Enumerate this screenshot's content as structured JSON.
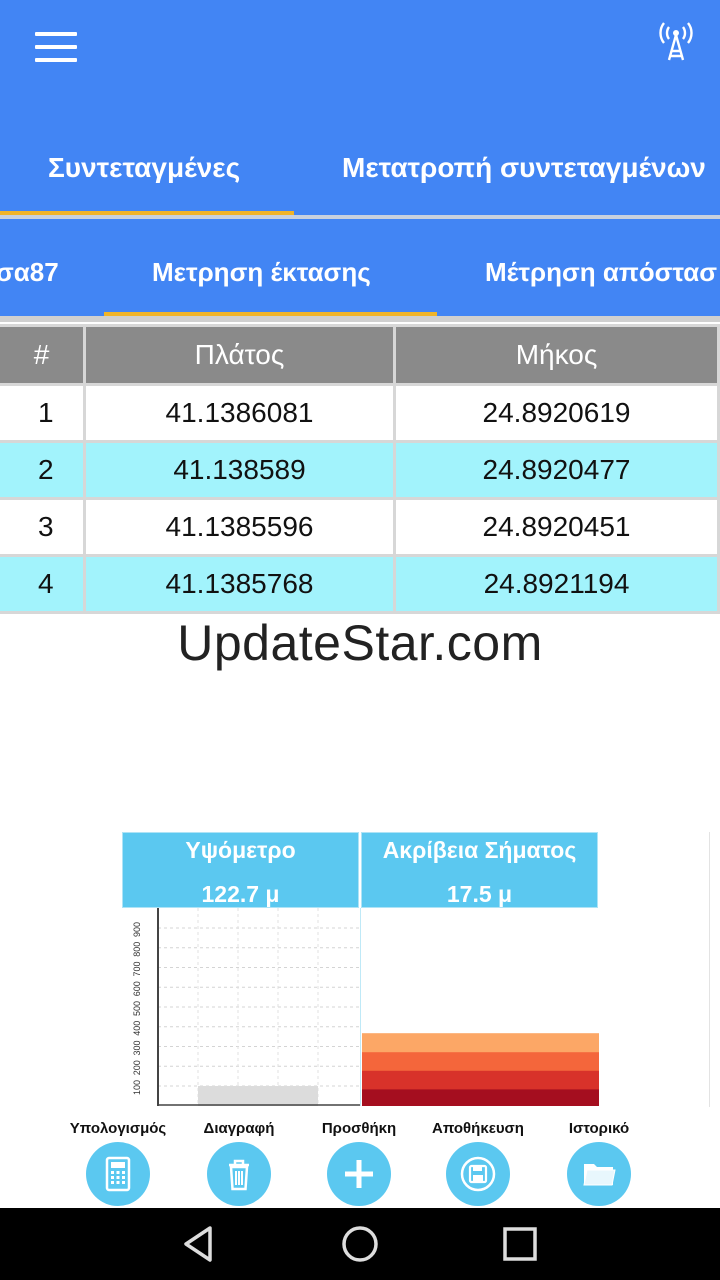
{
  "header": {
    "menu_icon": "hamburger-menu-icon",
    "gps_icon": "antenna-icon",
    "color": "#4285f4"
  },
  "main_tabs": [
    {
      "label": "Συντεταγμένες",
      "selected": true
    },
    {
      "label": "Μετατροπή συντεταγμένων",
      "selected": false
    }
  ],
  "sub_tabs": [
    {
      "label": "σα87",
      "selected": false
    },
    {
      "label": "Μετρηση έκτασης",
      "selected": true
    },
    {
      "label": "Μέτρηση απόστασ",
      "selected": false
    }
  ],
  "table": {
    "headers": [
      "#",
      "Πλάτος",
      "Μήκος"
    ],
    "rows": [
      [
        "1",
        "41.1386081",
        "24.8920619"
      ],
      [
        "2",
        "41.138589",
        "24.8920477"
      ],
      [
        "3",
        "41.1385596",
        "24.8920451"
      ],
      [
        "4",
        "41.1385768",
        "24.8921194"
      ]
    ]
  },
  "watermark": "UpdateStar.com",
  "altitude": {
    "label": "Υψόμετρο",
    "value": "122.7 μ",
    "axis_ticks": [
      "100",
      "200",
      "300",
      "400",
      "500",
      "600",
      "700",
      "800",
      "900"
    ]
  },
  "accuracy": {
    "label": "Ακρίβεια Σήματος",
    "value": "17.5 μ",
    "level_colors": [
      "#a50e1f",
      "#d8322a",
      "#f4663b",
      "#fca766"
    ]
  },
  "actions": [
    {
      "label": "Υπολογισμός",
      "icon": "calculator-icon"
    },
    {
      "label": "Διαγραφή",
      "icon": "trash-icon"
    },
    {
      "label": "Προσθήκη",
      "icon": "plus-icon"
    },
    {
      "label": "Αποθήκευση",
      "icon": "save-icon"
    },
    {
      "label": "Ιστορικό",
      "icon": "folder-icon"
    }
  ],
  "nav": {
    "back_icon": "back-icon",
    "home_icon": "home-icon",
    "recents_icon": "recents-icon"
  }
}
